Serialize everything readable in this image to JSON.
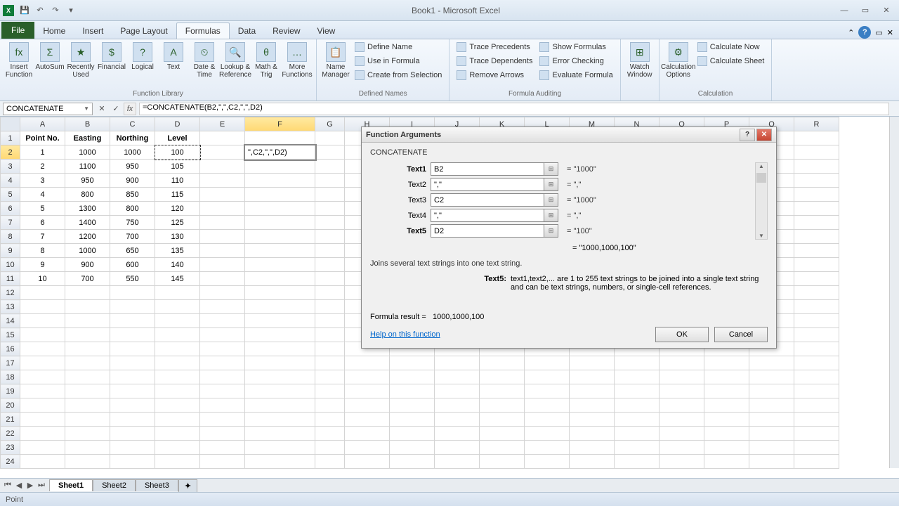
{
  "title": "Book1 - Microsoft Excel",
  "tabs": {
    "file": "File",
    "home": "Home",
    "insert": "Insert",
    "page_layout": "Page Layout",
    "formulas": "Formulas",
    "data": "Data",
    "review": "Review",
    "view": "View"
  },
  "ribbon": {
    "insert_function": "Insert Function",
    "autosum": "AutoSum",
    "recently_used": "Recently Used",
    "financial": "Financial",
    "logical": "Logical",
    "text": "Text",
    "date_time": "Date & Time",
    "lookup_ref": "Lookup & Reference",
    "math_trig": "Math & Trig",
    "more_functions": "More Functions",
    "function_library": "Function Library",
    "name_manager": "Name Manager",
    "define_name": "Define Name",
    "use_in_formula": "Use in Formula",
    "create_from_selection": "Create from Selection",
    "defined_names": "Defined Names",
    "trace_precedents": "Trace Precedents",
    "trace_dependents": "Trace Dependents",
    "remove_arrows": "Remove Arrows",
    "show_formulas": "Show Formulas",
    "error_checking": "Error Checking",
    "evaluate_formula": "Evaluate Formula",
    "formula_auditing": "Formula Auditing",
    "watch_window": "Watch Window",
    "calculation_options": "Calculation Options",
    "calculate_now": "Calculate Now",
    "calculate_sheet": "Calculate Sheet",
    "calculation": "Calculation"
  },
  "name_box": "CONCATENATE",
  "formula": "=CONCATENATE(B2,\",\",C2,\",\",D2)",
  "columns": [
    "A",
    "B",
    "C",
    "D",
    "E",
    "F",
    "G",
    "H",
    "I",
    "J",
    "K",
    "L",
    "M",
    "N",
    "O",
    "P",
    "Q",
    "R"
  ],
  "headers": {
    "A": "Point No.",
    "B": "Easting",
    "C": "Northing",
    "D": "Level"
  },
  "data": [
    {
      "A": "1",
      "B": "1000",
      "C": "1000",
      "D": "100"
    },
    {
      "A": "2",
      "B": "1100",
      "C": "950",
      "D": "105"
    },
    {
      "A": "3",
      "B": "950",
      "C": "900",
      "D": "110"
    },
    {
      "A": "4",
      "B": "800",
      "C": "850",
      "D": "115"
    },
    {
      "A": "5",
      "B": "1300",
      "C": "800",
      "D": "120"
    },
    {
      "A": "6",
      "B": "1400",
      "C": "750",
      "D": "125"
    },
    {
      "A": "7",
      "B": "1200",
      "C": "700",
      "D": "130"
    },
    {
      "A": "8",
      "B": "1000",
      "C": "650",
      "D": "135"
    },
    {
      "A": "9",
      "B": "900",
      "C": "600",
      "D": "140"
    },
    {
      "A": "10",
      "B": "700",
      "C": "550",
      "D": "145"
    }
  ],
  "editing_cell": "\",C2,\",\",D2)",
  "dialog": {
    "title": "Function Arguments",
    "func": "CONCATENATE",
    "args": [
      {
        "label": "Text1",
        "bold": true,
        "value": "B2",
        "result": "\"1000\""
      },
      {
        "label": "Text2",
        "bold": false,
        "value": "\",\"",
        "result": "\",\""
      },
      {
        "label": "Text3",
        "bold": false,
        "value": "C2",
        "result": "\"1000\""
      },
      {
        "label": "Text4",
        "bold": false,
        "value": "\",\"",
        "result": "\",\""
      },
      {
        "label": "Text5",
        "bold": true,
        "value": "D2",
        "result": "\"100\""
      }
    ],
    "overall_result": "\"1000,1000,100\"",
    "description": "Joins several text strings into one text string.",
    "arg_desc_label": "Text5:",
    "arg_desc_text": "text1,text2,... are 1 to 255 text strings to be joined into a single text string and can be text strings, numbers, or single-cell references.",
    "formula_result_label": "Formula result =",
    "formula_result_value": "1000,1000,100",
    "help_link": "Help on this function",
    "ok": "OK",
    "cancel": "Cancel"
  },
  "sheets": [
    "Sheet1",
    "Sheet2",
    "Sheet3"
  ],
  "status": "Point"
}
